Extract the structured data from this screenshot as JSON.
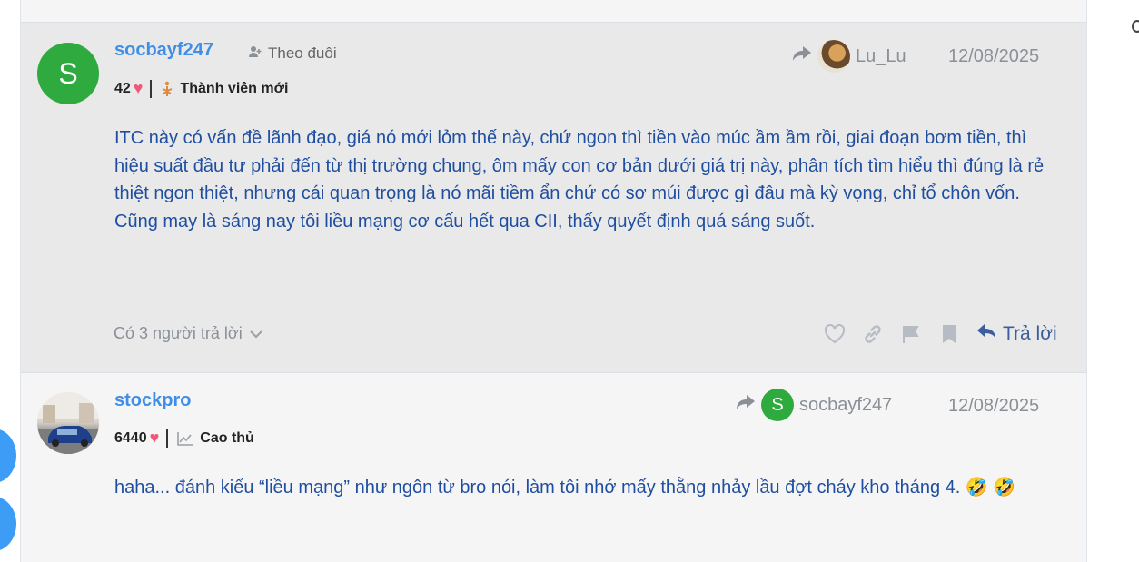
{
  "posts": [
    {
      "username": "socbayf247",
      "avatar_letter": "S",
      "follow_label": "Theo đuôi",
      "likes": "42",
      "rank": "Thành viên mới",
      "reply_to_user": "Lu_Lu",
      "date": "12/08/2025",
      "content": "ITC này có vấn đề lãnh đạo, giá nó mới lỏm thế này, chứ ngon thì tiền vào múc ầm ầm rồi, giai đoạn bơm tiền, thì hiệu suất đầu tư phải đến từ thị trường chung, ôm mấy con cơ bản dưới giá trị này, phân tích tìm hiểu thì đúng là rẻ thiệt ngon thiệt, nhưng cái quan trọng là nó mãi tiềm ẩn chứ có sơ múi được gì đâu mà kỳ vọng, chỉ tổ chôn vốn. Cũng may là sáng nay tôi liều mạng cơ cấu hết qua CII, thấy quyết định quá sáng suốt.",
      "replies_toggle": "Có 3 người trả lời",
      "reply_button": "Trả lời"
    },
    {
      "username": "stockpro",
      "likes": "6440",
      "rank": "Cao thủ",
      "reply_to_user": "socbayf247",
      "reply_to_avatar_letter": "S",
      "date": "12/08/2025",
      "content": "haha... đánh kiểu “liều mạng” như ngôn từ bro nói, làm tôi nhớ mấy thằng nhảy lầu đợt cháy kho tháng 4. 🤣 🤣"
    }
  ],
  "colors": {
    "username": "#3f8ee8",
    "content": "#1f4ea0",
    "avatar_green": "#2faa3f",
    "heart": "#f0587a",
    "post_bg_active": "#e9e9e9",
    "post_bg": "#f5f5f5"
  },
  "icons": [
    "follow-icon",
    "heart-icon",
    "new-member-icon",
    "share-arrow-icon",
    "chevron-down-icon",
    "like-icon",
    "link-icon",
    "flag-icon",
    "bookmark-icon",
    "reply-icon",
    "chart-icon"
  ]
}
